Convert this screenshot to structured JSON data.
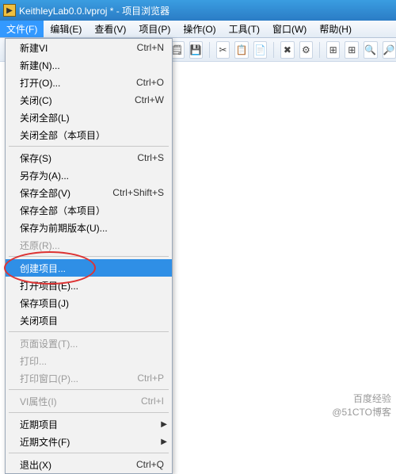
{
  "titlebar": {
    "title": "KeithleyLab0.0.lvproj * - 项目浏览器"
  },
  "menubar": {
    "items": [
      {
        "label": "文件(F)",
        "active": true
      },
      {
        "label": "编辑(E)"
      },
      {
        "label": "查看(V)"
      },
      {
        "label": "项目(P)"
      },
      {
        "label": "操作(O)"
      },
      {
        "label": "工具(T)"
      },
      {
        "label": "窗口(W)"
      },
      {
        "label": "帮助(H)"
      }
    ]
  },
  "toolbar_icons": [
    "🗒",
    "💾",
    "✂",
    "📋",
    "📄",
    "✖",
    "⚙",
    "⊞",
    "⊞",
    "🔍",
    "🔎"
  ],
  "dropdown": [
    {
      "type": "item",
      "label": "新建VI",
      "shortcut": "Ctrl+N"
    },
    {
      "type": "item",
      "label": "新建(N)...",
      "shortcut": ""
    },
    {
      "type": "item",
      "label": "打开(O)...",
      "shortcut": "Ctrl+O"
    },
    {
      "type": "item",
      "label": "关闭(C)",
      "shortcut": "Ctrl+W"
    },
    {
      "type": "item",
      "label": "关闭全部(L)",
      "shortcut": ""
    },
    {
      "type": "item",
      "label": "关闭全部（本项目）",
      "shortcut": ""
    },
    {
      "type": "sep"
    },
    {
      "type": "item",
      "label": "保存(S)",
      "shortcut": "Ctrl+S"
    },
    {
      "type": "item",
      "label": "另存为(A)...",
      "shortcut": ""
    },
    {
      "type": "item",
      "label": "保存全部(V)",
      "shortcut": "Ctrl+Shift+S"
    },
    {
      "type": "item",
      "label": "保存全部（本项目）",
      "shortcut": ""
    },
    {
      "type": "item",
      "label": "保存为前期版本(U)...",
      "shortcut": ""
    },
    {
      "type": "item",
      "label": "还原(R)...",
      "shortcut": "",
      "disabled": true
    },
    {
      "type": "sep"
    },
    {
      "type": "item",
      "label": "创建项目...",
      "shortcut": "",
      "highlight": true
    },
    {
      "type": "item",
      "label": "打开项目(E)...",
      "shortcut": ""
    },
    {
      "type": "item",
      "label": "保存项目(J)",
      "shortcut": ""
    },
    {
      "type": "item",
      "label": "关闭项目",
      "shortcut": ""
    },
    {
      "type": "sep"
    },
    {
      "type": "item",
      "label": "页面设置(T)...",
      "shortcut": "",
      "disabled": true
    },
    {
      "type": "item",
      "label": "打印...",
      "shortcut": "",
      "disabled": true
    },
    {
      "type": "item",
      "label": "打印窗口(P)...",
      "shortcut": "Ctrl+P",
      "disabled": true
    },
    {
      "type": "sep"
    },
    {
      "type": "item",
      "label": "VI属性(I)",
      "shortcut": "Ctrl+I",
      "disabled": true
    },
    {
      "type": "sep"
    },
    {
      "type": "item",
      "label": "近期项目",
      "shortcut": "",
      "submenu": true
    },
    {
      "type": "item",
      "label": "近期文件(F)",
      "shortcut": "",
      "submenu": true
    },
    {
      "type": "sep"
    },
    {
      "type": "item",
      "label": "退出(X)",
      "shortcut": "Ctrl+Q"
    }
  ],
  "watermark": {
    "line1": "百度经验",
    "line2": "@51CTO博客"
  }
}
